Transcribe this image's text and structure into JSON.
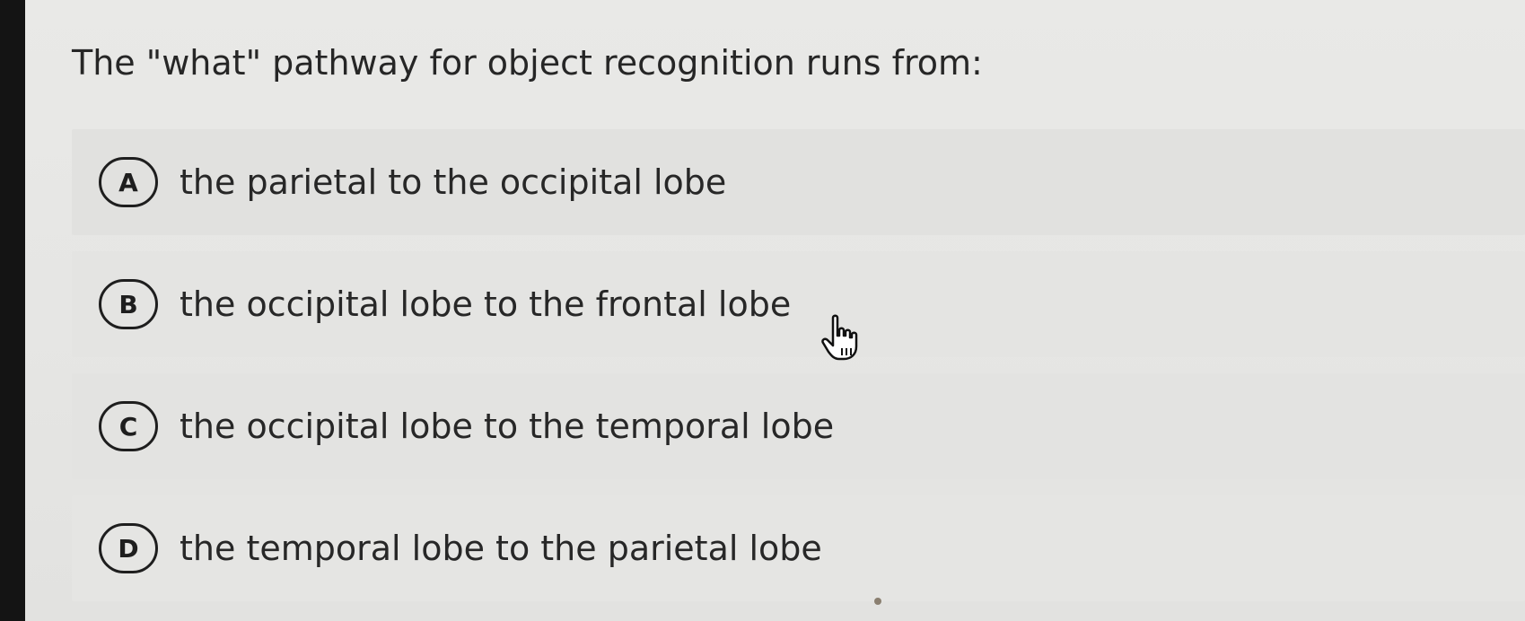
{
  "question": {
    "text": "The \"what\" pathway for object recognition runs from:"
  },
  "options": [
    {
      "letter": "A",
      "text": "the parietal to the occipital lobe"
    },
    {
      "letter": "B",
      "text": "the occipital lobe to the frontal lobe"
    },
    {
      "letter": "C",
      "text": "the occipital lobe to the temporal lobe"
    },
    {
      "letter": "D",
      "text": "the temporal lobe to the parietal lobe"
    }
  ],
  "icons": {
    "cursor": "hand-pointer-icon"
  },
  "colors": {
    "panel_background": "#e6e6e4",
    "text": "#262626",
    "badge_border": "#1e1e1e"
  }
}
